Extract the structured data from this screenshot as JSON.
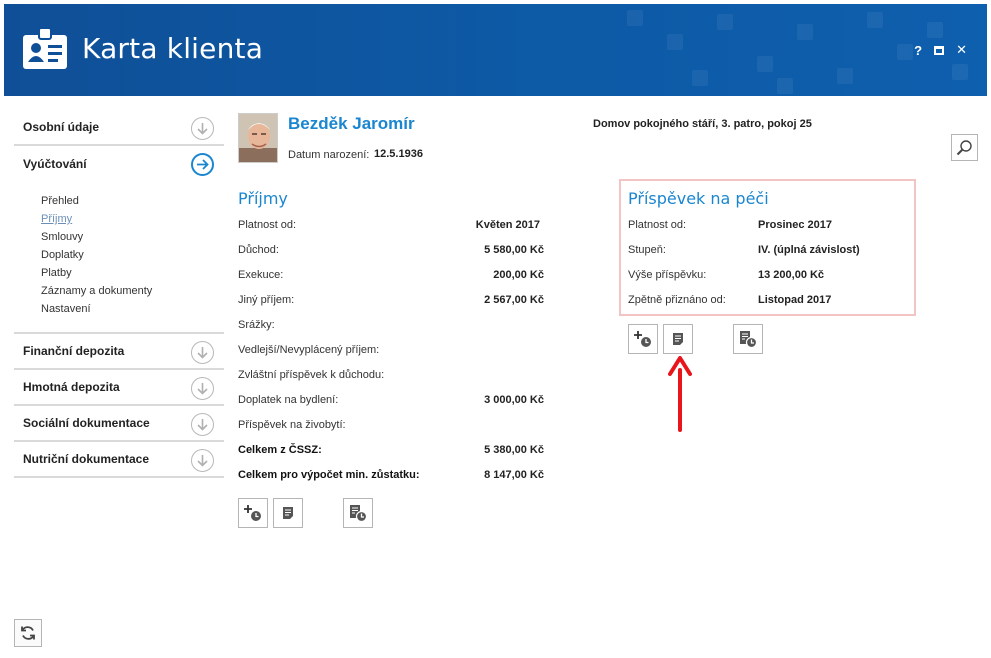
{
  "app": {
    "title": "Karta klienta",
    "controls": {
      "help": "?",
      "close": "✕"
    }
  },
  "sidebar": {
    "items": [
      {
        "label": "Osobní údaje"
      },
      {
        "label": "Vyúčtování"
      },
      {
        "label": "Finanční depozita"
      },
      {
        "label": "Hmotná depozita"
      },
      {
        "label": "Sociální dokumentace"
      },
      {
        "label": "Nutriční dokumentace"
      }
    ],
    "submenu": [
      {
        "label": "Přehled"
      },
      {
        "label": "Příjmy"
      },
      {
        "label": "Smlouvy"
      },
      {
        "label": "Doplatky"
      },
      {
        "label": "Platby"
      },
      {
        "label": "Záznamy a dokumenty"
      },
      {
        "label": "Nastavení"
      }
    ]
  },
  "client": {
    "name": "Bezděk Jaromír",
    "dob_label": "Datum narození:",
    "dob": "12.5.1936",
    "location": "Domov pokojného stáří, 3. patro, pokoj 25"
  },
  "income": {
    "title": "Příjmy",
    "rows": [
      {
        "label": "Platnost od:",
        "value": "Květen 2017"
      },
      {
        "label": "Důchod:",
        "value": "5 580,00 Kč"
      },
      {
        "label": "Exekuce:",
        "value": "200,00 Kč"
      },
      {
        "label": "Jiný příjem:",
        "value": "2 567,00 Kč"
      },
      {
        "label": "Srážky:",
        "value": ""
      },
      {
        "label": "Vedlejší/Nevyplácený příjem:",
        "value": ""
      },
      {
        "label": "Zvláštní příspěvek k důchodu:",
        "value": ""
      },
      {
        "label": "Doplatek na bydlení:",
        "value": "3 000,00 Kč"
      },
      {
        "label": "Příspěvek na živobytí:",
        "value": ""
      },
      {
        "label": "Celkem z ČSSZ:",
        "value": "5 380,00 Kč"
      },
      {
        "label": "Celkem pro výpočet min. zůstatku:",
        "value": "8 147,00 Kč"
      }
    ]
  },
  "care": {
    "title": "Příspěvek na péči",
    "rows": [
      {
        "label": "Platnost od:",
        "value": "Prosinec 2017"
      },
      {
        "label": "Stupeň:",
        "value": "IV. (úplná závislost)"
      },
      {
        "label": "Výše příspěvku:",
        "value": "13 200,00 Kč"
      },
      {
        "label": "Zpětně přiznáno od:",
        "value": "Listopad 2017"
      }
    ]
  },
  "icons": {
    "add_history": "add-history-icon",
    "detail": "document-icon",
    "history": "history-icon",
    "search": "magnifier-icon",
    "refresh": "refresh-icon"
  },
  "colors": {
    "header": "#0f4f97",
    "accent": "#1a86d0",
    "highlight_border": "#f2c4c4",
    "annotation_arrow": "#e8161c"
  }
}
